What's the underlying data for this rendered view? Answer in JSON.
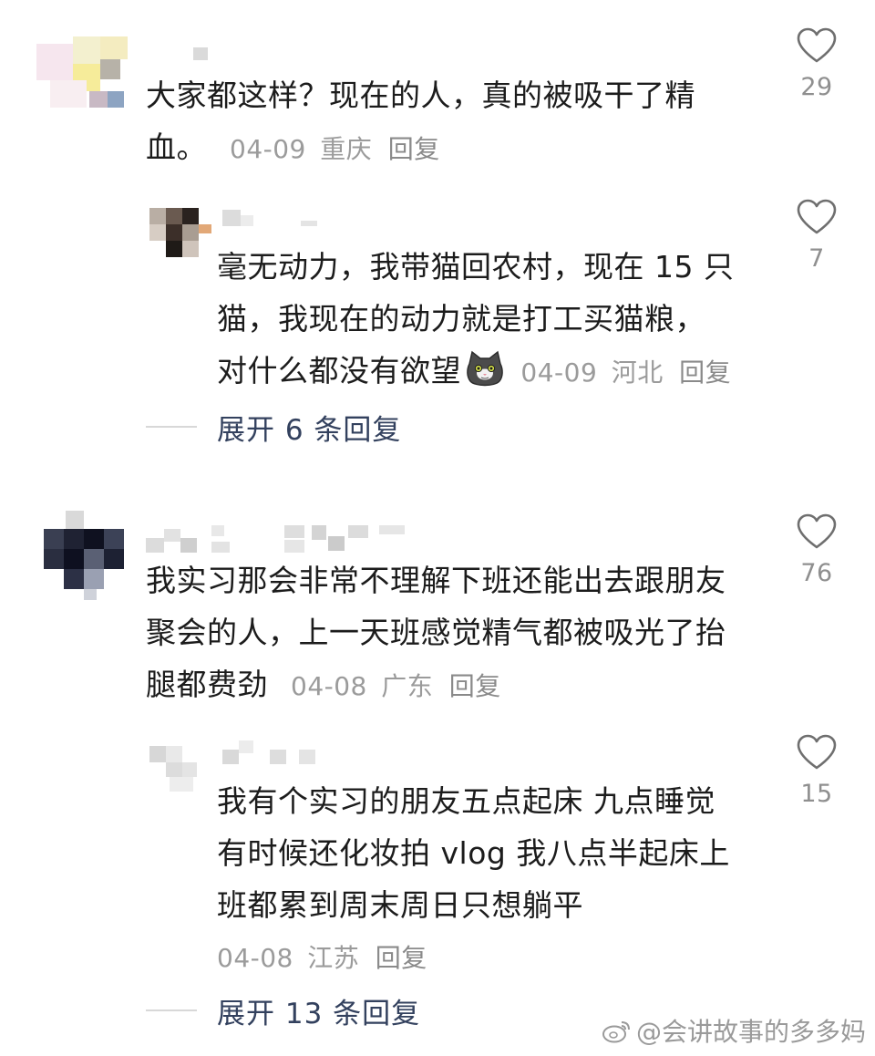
{
  "comments": [
    {
      "lines": [
        "大家都这样？现在的人，真的被吸干了精",
        "血。"
      ],
      "date": "04-09",
      "location": "重庆",
      "reply_label": "回复",
      "likes": "29",
      "replies": [
        {
          "lines": [
            "毫无动力，我带猫回农村，现在 15 只",
            "猫，我现在的动力就是打工买猫粮，",
            "对什么都没有欲望"
          ],
          "emoji": "cat-face-icon",
          "date": "04-09",
          "location": "河北",
          "reply_label": "回复",
          "likes": "7"
        }
      ],
      "expand_label": "展开 6 条回复"
    },
    {
      "lines": [
        "我实习那会非常不理解下班还能出去跟朋友",
        "聚会的人，上一天班感觉精气都被吸光了抬",
        "腿都费劲"
      ],
      "date": "04-08",
      "location": "广东",
      "reply_label": "回复",
      "likes": "76",
      "replies": [
        {
          "lines": [
            "我有个实习的朋友五点起床 九点睡觉",
            "有时候还化妆拍 vlog 我八点半起床上",
            "班都累到周末周日只想躺平"
          ],
          "date": "04-08",
          "location": "江苏",
          "reply_label": "回复",
          "likes": "15"
        }
      ],
      "expand_label": "展开 13 条回复"
    }
  ],
  "watermark": "@会讲故事的多多妈",
  "colors": {
    "text": "#1c1c1c",
    "meta": "#9b9b9b",
    "expand": "#33415e",
    "like_icon": "#6f6f6f"
  }
}
